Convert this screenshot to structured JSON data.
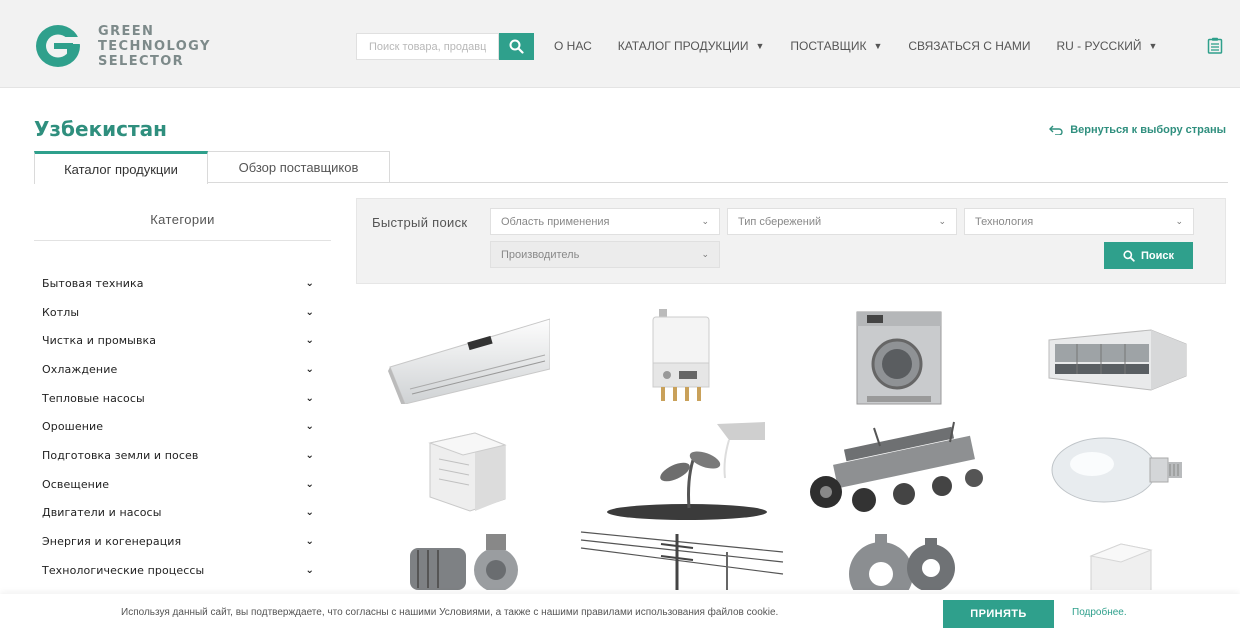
{
  "header": {
    "logo_lines": [
      "GREEN",
      "TECHNOLOGY",
      "SELECTOR"
    ],
    "search_placeholder": "Поиск товара, продавца",
    "nav": [
      {
        "label": "О НАС",
        "has_dropdown": false
      },
      {
        "label": "КАТАЛОГ ПРОДУКЦИИ",
        "has_dropdown": true
      },
      {
        "label": "ПОСТАВЩИК",
        "has_dropdown": true
      },
      {
        "label": "СВЯЗАТЬСЯ С НАМИ",
        "has_dropdown": false
      },
      {
        "label": "RU - РУССКИЙ",
        "has_dropdown": true
      }
    ]
  },
  "page": {
    "title": "Узбекистан",
    "back_link": "Вернуться к выбору страны"
  },
  "tabs": [
    {
      "label": "Каталог продукции",
      "active": true
    },
    {
      "label": "Обзор поставщиков",
      "active": false
    }
  ],
  "sidebar": {
    "title": "Категории",
    "items": [
      "Бытовая техника",
      "Котлы",
      "Чистка и промывка",
      "Охлаждение",
      "Тепловые насосы",
      "Орошение",
      "Подготовка земли и посев",
      "Освещение",
      "Двигатели и насосы",
      "Энергия и когенерация",
      "Технологические процессы"
    ]
  },
  "quick_search": {
    "label": "Быстрый поиск",
    "filters": [
      {
        "placeholder": "Область применения",
        "disabled": false
      },
      {
        "placeholder": "Тип сбережений",
        "disabled": false
      },
      {
        "placeholder": "Технология",
        "disabled": false
      },
      {
        "placeholder": "Производитель",
        "disabled": true
      }
    ],
    "button": "Поиск"
  },
  "products": [
    {
      "icon": "air-conditioner-icon"
    },
    {
      "icon": "boiler-icon"
    },
    {
      "icon": "washing-machine-icon"
    },
    {
      "icon": "industrial-chiller-icon"
    },
    {
      "icon": "heat-pump-icon"
    },
    {
      "icon": "irrigation-sprout-icon"
    },
    {
      "icon": "seeder-machine-icon"
    },
    {
      "icon": "led-bulb-icon"
    },
    {
      "icon": "motor-pump-icon"
    },
    {
      "icon": "power-lines-icon"
    },
    {
      "icon": "gears-icon"
    },
    {
      "icon": "white-unit-icon"
    }
  ],
  "cookie": {
    "text": "Используя данный сайт, вы подтверждаете, что согласны с нашими Условиями, а также с нашими правилами использования файлов cookie.",
    "accept": "ПРИНЯТЬ",
    "more": "Подробнее."
  },
  "colors": {
    "accent": "#2fa08c",
    "title": "#2f8f7e",
    "header_bg": "#f2f2f2"
  }
}
